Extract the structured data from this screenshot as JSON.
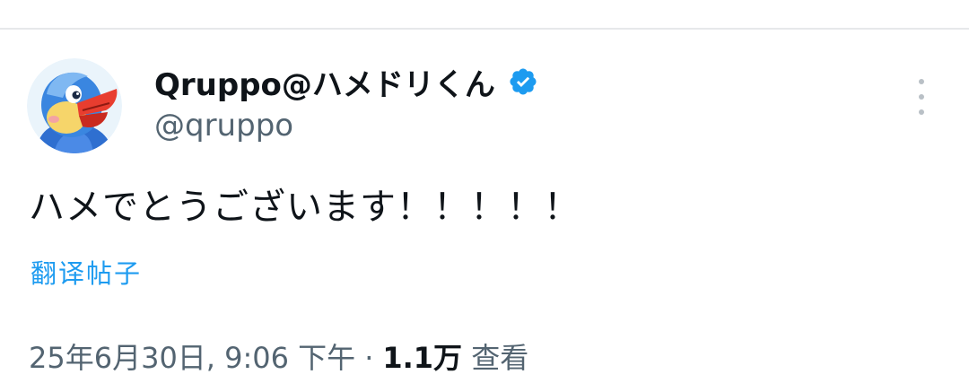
{
  "tweet": {
    "author": {
      "display_name": "Qruppo@ハメドリくん",
      "handle": "@qruppo",
      "verified": true,
      "avatar": "blue-bird-mascot-avatar"
    },
    "text": "ハメでとうございます！！！！！",
    "translate_label": "翻译帖子",
    "meta": {
      "timestamp": "25年6月30日, 9:06 下午",
      "separator": "·",
      "views_count": "1.1万",
      "views_label": "查看"
    }
  },
  "icons": {
    "verified": "verified-badge-icon",
    "more": "more-options-icon"
  },
  "colors": {
    "link": "#1d9bf0",
    "verified": "#1d9bf0",
    "secondary_text": "#536471",
    "primary_text": "#0f1419"
  }
}
